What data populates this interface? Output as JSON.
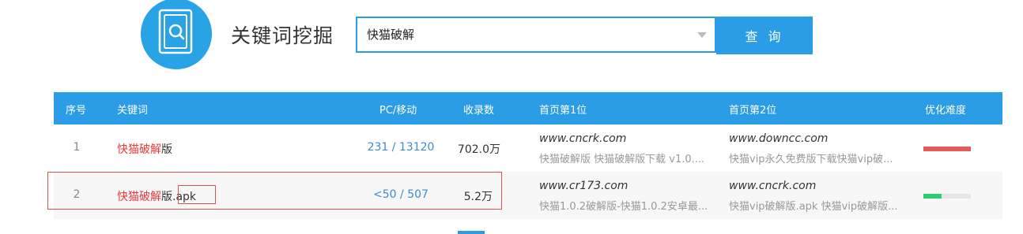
{
  "header": {
    "title": "关键词挖掘",
    "logo_icon": "keyword-search-icon"
  },
  "search": {
    "value": "快猫破解",
    "button_label": "查 询"
  },
  "colors": {
    "accent": "#2b9ce6",
    "keyword_highlight": "#e23a3a",
    "difficulty_high": "#e55a5a",
    "difficulty_low": "#2ecc71"
  },
  "table": {
    "headers": {
      "index": "序号",
      "keyword": "关键词",
      "pc_mobile": "PC/移动",
      "indexed": "收录数",
      "rank1": "首页第1位",
      "rank2": "首页第2位",
      "difficulty": "优化难度"
    },
    "rows": [
      {
        "index": "1",
        "keyword_highlight": "快猫破解",
        "keyword_rest": "版",
        "pc_mobile": "231 / 13120",
        "indexed": "702.0万",
        "rank1_url": "www.cncrk.com",
        "rank1_title": "快猫破解版 快猫破解版下载 v1.0....",
        "rank2_url": "www.downcc.com",
        "rank2_title": "快猫vip永久免费版下载快猫vip破...",
        "difficulty": 1.0
      },
      {
        "index": "2",
        "keyword_highlight": "快猫破解",
        "keyword_rest": "版.apk",
        "pc_mobile": "<50 / 507",
        "indexed": "5.2万",
        "rank1_url": "www.cr173.com",
        "rank1_title": "快猫1.0.2破解版-快猫1.0.2安卓最...",
        "rank2_url": "www.cncrk.com",
        "rank2_title": "快猫vip破解版.apk 快猫vip破解版...",
        "difficulty": 0.38
      }
    ]
  }
}
